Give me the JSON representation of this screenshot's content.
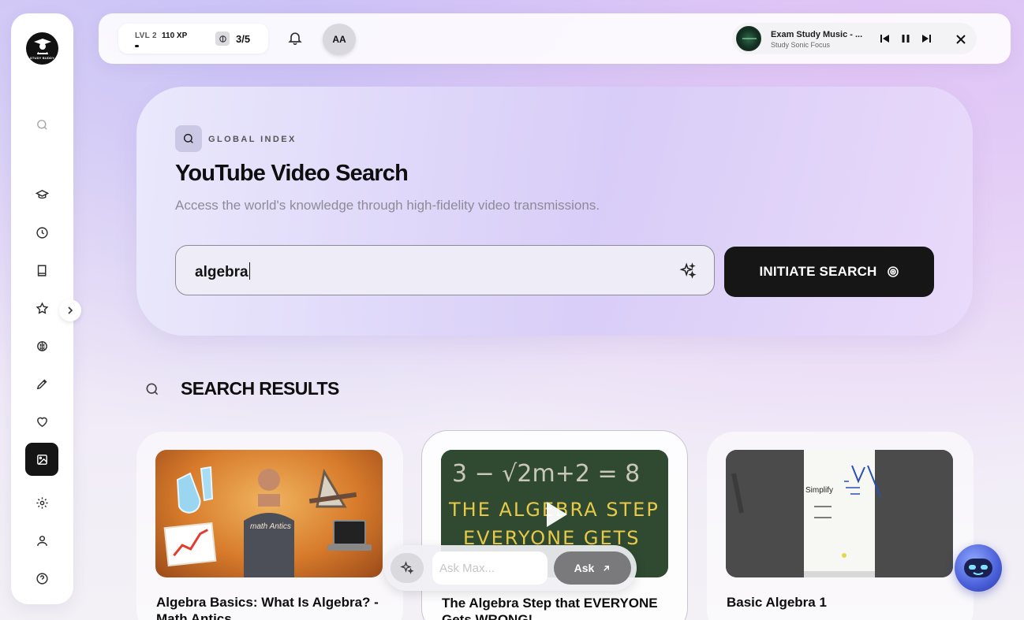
{
  "sidebar": {
    "logo_text": "STUDY BUDDY",
    "items": [
      {
        "name": "search"
      },
      {
        "name": "graduation-cap"
      },
      {
        "name": "clock"
      },
      {
        "name": "book"
      },
      {
        "name": "star"
      },
      {
        "name": "brain"
      },
      {
        "name": "pencil"
      },
      {
        "name": "heart"
      },
      {
        "name": "image",
        "active": true
      },
      {
        "name": "gear"
      },
      {
        "name": "user"
      },
      {
        "name": "help"
      }
    ]
  },
  "topbar": {
    "level_label": "LVL 2",
    "xp_label": "110 XP",
    "xp_progress": 0.1,
    "energy": "3/5",
    "avatar_initials": "AA",
    "player": {
      "track_title": "Exam Study Music - ...",
      "artist": "Study Sonic Focus"
    }
  },
  "hero": {
    "eyebrow": "GLOBAL INDEX",
    "title": "YouTube Video Search",
    "subtitle": "Access the world's knowledge through high-fidelity video transmissions.",
    "search_value": "algebra",
    "search_button": "INITIATE SEARCH"
  },
  "results": {
    "heading": "SEARCH RESULTS",
    "cards": [
      {
        "title": "Algebra Basics: What Is Algebra? - Math Antics",
        "thumb_text": "math Antics"
      },
      {
        "title": "The Algebra Step that EVERYONE Gets WRONG!",
        "thumb_line1": "3 − √2m+2 = 8",
        "thumb_line2": "THE ALGEBRA STEP",
        "thumb_line3": "EVERYONE GETS"
      },
      {
        "title": "Basic Algebra 1",
        "thumb_text": "Simplify"
      }
    ]
  },
  "ask": {
    "placeholder": "Ask Max...",
    "button": "Ask"
  },
  "colors": {
    "accent_dark": "#161616",
    "hero_gradient_mid": "#d8cdf8",
    "chalkboard": "#30492f",
    "chalk_text": "#e8c94a"
  }
}
